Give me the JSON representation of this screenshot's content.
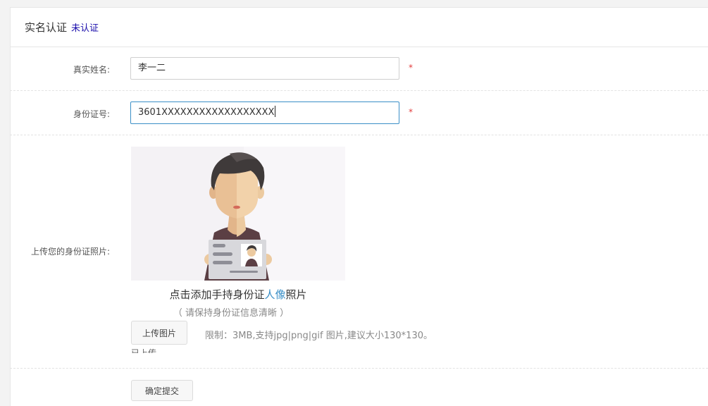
{
  "header": {
    "title": "实名认证",
    "status": "未认证"
  },
  "form": {
    "name_label": "真实姓名:",
    "name_value": "李一二",
    "id_label": "身份证号:",
    "id_value": "3601XXXXXXXXXXXXXXXXXX",
    "required_mark": "*",
    "upload_label": "上传您的身份证照片:",
    "upload_caption_prefix": "点击添加手持身份证",
    "upload_caption_highlight": "人像",
    "upload_caption_suffix": "照片",
    "upload_hint": "（ 请保持身份证信息清晰 ）",
    "upload_button": "上传图片",
    "limit_text": "限制：3MB,支持jpg|png|gif 图片,建议大小130*130。",
    "clipped_text": "已上传",
    "submit_button": "确定提交"
  },
  "colors": {
    "status_link": "#1a0dab",
    "accent": "#3a8fc7",
    "required": "#e23b3b"
  }
}
